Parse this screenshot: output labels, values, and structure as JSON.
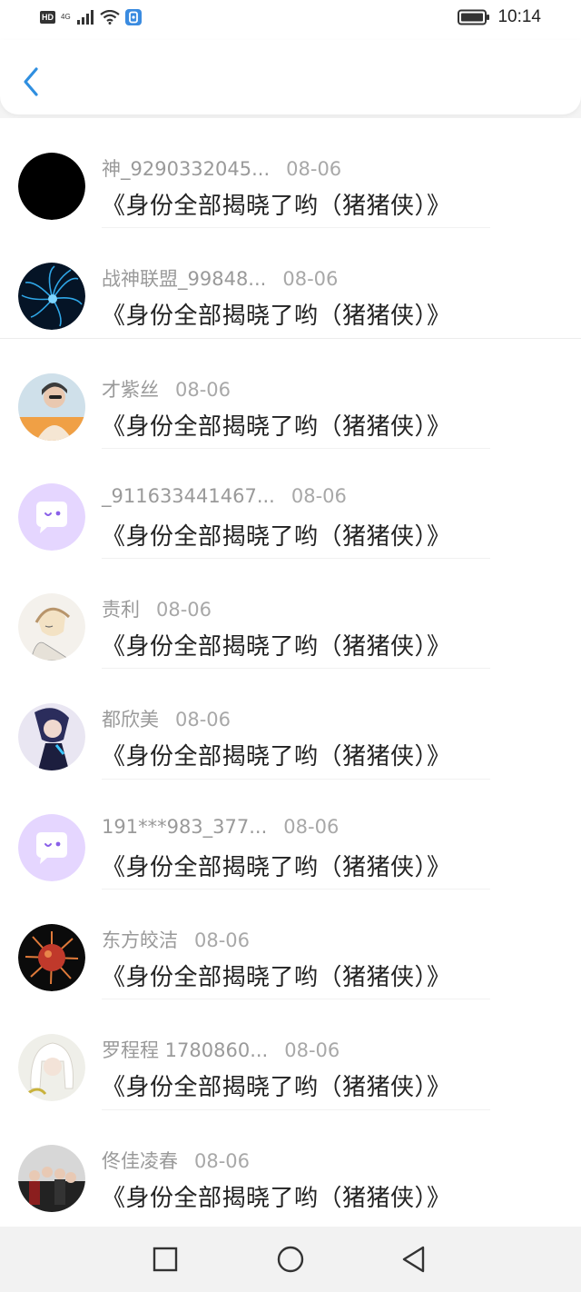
{
  "status_bar": {
    "hd": "HD",
    "network": "4G",
    "time": "10:14"
  },
  "header": {
    "back_icon": "chevron-left-icon",
    "accent_color": "#2f8fe0"
  },
  "items": [
    {
      "name": "神_9290332045...",
      "date": "08-06",
      "title": "《身份全部揭晓了哟（猪猪侠）》"
    },
    {
      "name": "战神联盟_99848...",
      "date": "08-06",
      "title": "《身份全部揭晓了哟（猪猪侠）》"
    },
    {
      "name": "才紫丝",
      "date": "08-06",
      "title": "《身份全部揭晓了哟（猪猪侠）》"
    },
    {
      "name": "_911633441467...",
      "date": "08-06",
      "title": "《身份全部揭晓了哟（猪猪侠）》"
    },
    {
      "name": "责利",
      "date": "08-06",
      "title": "《身份全部揭晓了哟（猪猪侠）》"
    },
    {
      "name": "都欣美",
      "date": "08-06",
      "title": "《身份全部揭晓了哟（猪猪侠）》"
    },
    {
      "name": "191***983_377...",
      "date": "08-06",
      "title": "《身份全部揭晓了哟（猪猪侠）》"
    },
    {
      "name": "东方皎洁",
      "date": "08-06",
      "title": "《身份全部揭晓了哟（猪猪侠）》"
    },
    {
      "name": "罗程程 1780860...",
      "date": "08-06",
      "title": "《身份全部揭晓了哟（猪猪侠）》"
    },
    {
      "name": "佟佳凌春",
      "date": "08-06",
      "title": "《身份全部揭晓了哟（猪猪侠）》"
    }
  ],
  "nav": {
    "recent": "square-icon",
    "home": "circle-icon",
    "back": "triangle-back-icon"
  }
}
